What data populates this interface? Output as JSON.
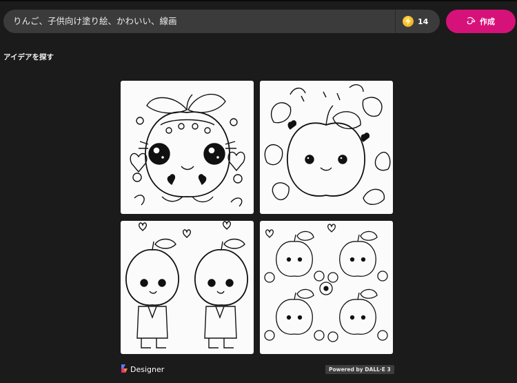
{
  "search": {
    "value": "りんご、子供向け塗り絵、かわいい、線画"
  },
  "boosts": {
    "count": "14",
    "icon": "boost-coin-icon"
  },
  "create_button": {
    "label": "作成",
    "icon": "paintbrush-icon"
  },
  "explore": {
    "heading": "アイデアを探す"
  },
  "gallery": {
    "images": [
      {
        "icon": "cute-apple-with-flowers-coloring-page"
      },
      {
        "icon": "apple-with-leaves-coloring-page"
      },
      {
        "icon": "two-apple-kids-coloring-page"
      },
      {
        "icon": "four-apples-with-flowers-coloring-page"
      }
    ]
  },
  "footer": {
    "brand": "Designer",
    "powered_by": "Powered by DALL·E 3"
  },
  "colors": {
    "accent": "#d6127a",
    "background": "#1c1b1b",
    "search_bg": "#3c3b3b",
    "coin": "#f3b92a"
  }
}
